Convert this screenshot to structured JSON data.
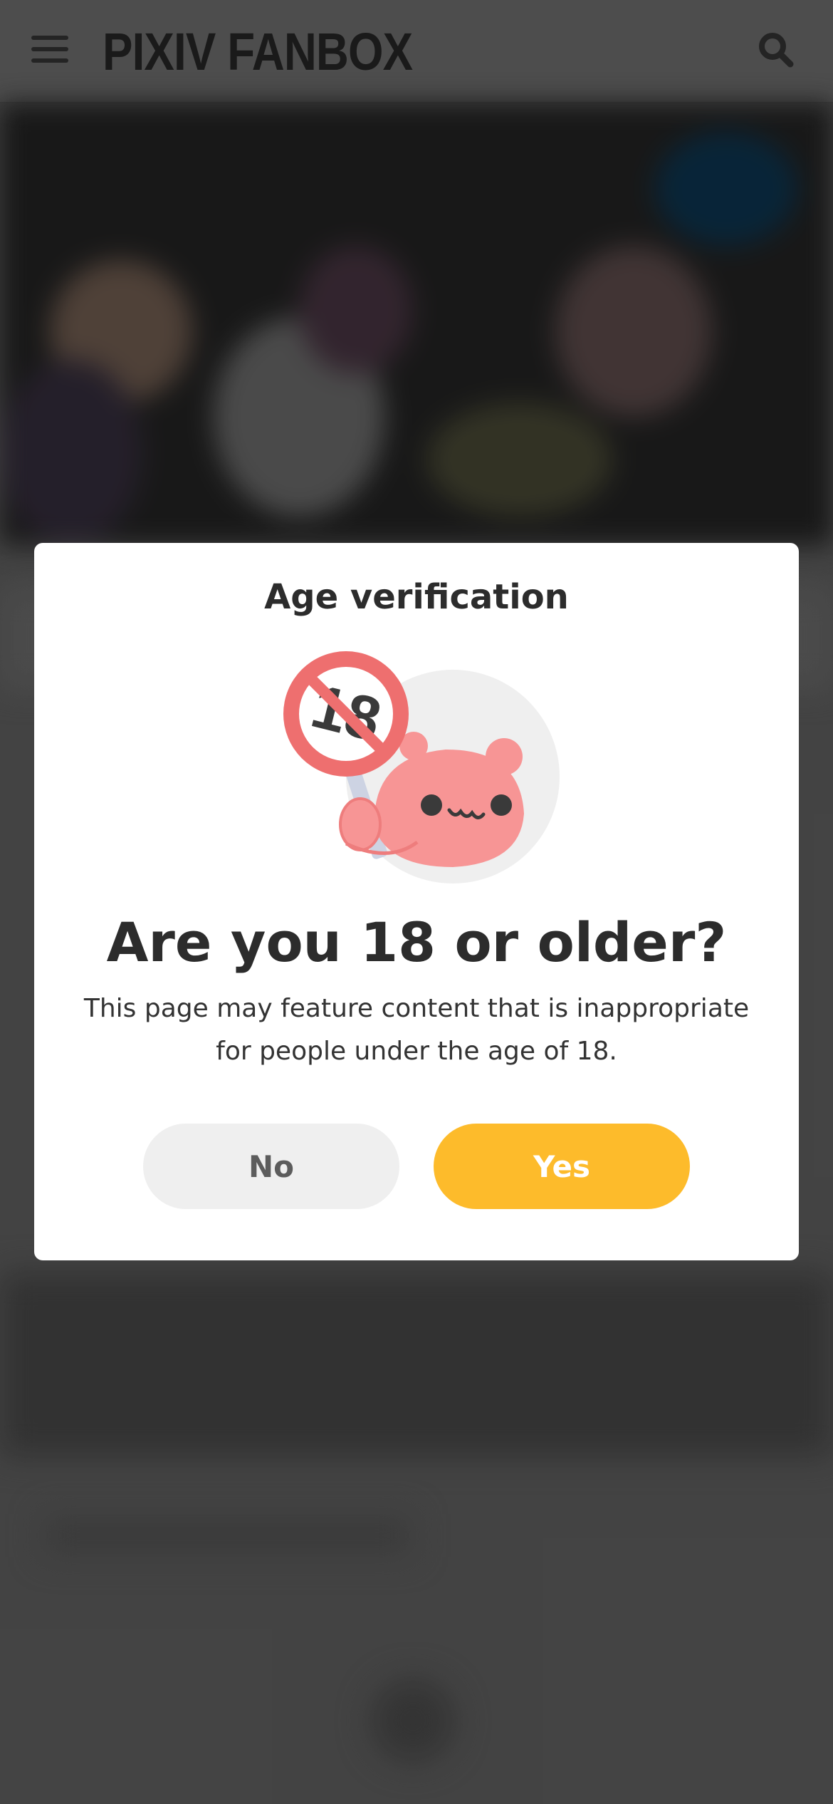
{
  "header": {
    "logo_text": "PIXIV FANBOX",
    "menu_icon": "hamburger-menu-icon",
    "search_icon": "search-icon"
  },
  "modal": {
    "title": "Age verification",
    "illustration": "under-18-prohibited-mascot-icon",
    "question": "Are you 18 or older?",
    "description_line1": "This page may feature content that is inappropriate",
    "description_line2": "for people under the age of 18.",
    "no_label": "No",
    "yes_label": "Yes",
    "illustration_sign_text": "18"
  },
  "colors": {
    "accent_yes": "#fdbb2b",
    "button_no_bg": "#efefef",
    "mascot_pink": "#f79595",
    "prohibit_red": "#ee6f6f"
  }
}
